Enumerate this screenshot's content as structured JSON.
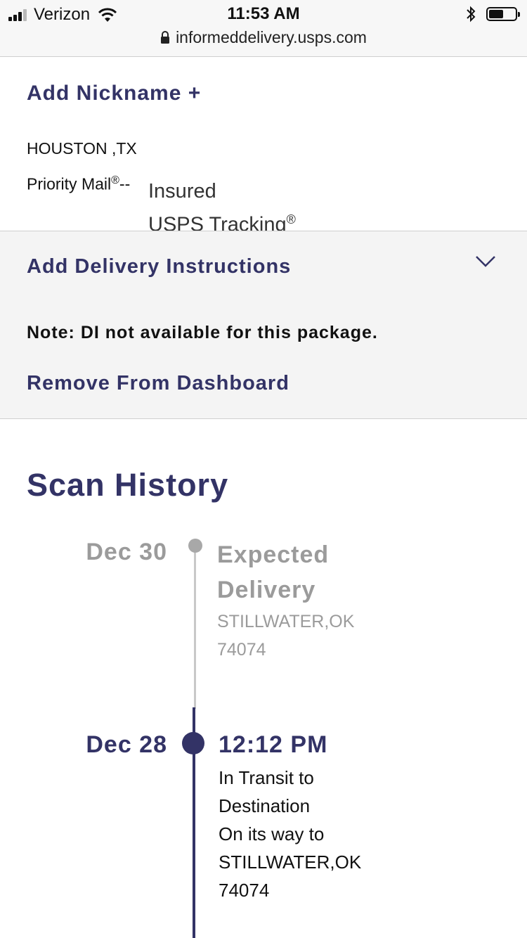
{
  "status_bar": {
    "carrier": "Verizon",
    "time": "11:53 AM",
    "url": "informeddelivery.usps.com",
    "signal_bars_filled": 3,
    "signal_bars_total": 4,
    "battery_level": 0.55
  },
  "package": {
    "nickname_link": "Add Nickname +",
    "origin": "HOUSTON ,TX",
    "service_name": "Priority Mail",
    "service_reg": "®",
    "service_sep": "--",
    "service_extra_line1": "Insured",
    "service_extra_line2": "USPS Tracking",
    "service_extra_reg": "®"
  },
  "delivery_instructions": {
    "title": "Add Delivery Instructions",
    "note": "Note: DI not available for this package."
  },
  "remove": {
    "label": "Remove From Dashboard"
  },
  "scan_history": {
    "title": "Scan History",
    "events": [
      {
        "date": "Dec 30",
        "title_line1": "Expected",
        "title_line2": "Delivery",
        "location_line1": "STILLWATER,OK",
        "location_line2": "74074"
      },
      {
        "date": "Dec 28",
        "time": "12:12 PM",
        "desc_line1": "In Transit to",
        "desc_line2": "Destination",
        "desc_line3": "On its way to",
        "desc_line4": "STILLWATER,OK",
        "desc_line5": "74074"
      }
    ]
  },
  "colors": {
    "brand_purple": "#333366",
    "muted_gray": "#9b9b9b",
    "section_bg": "#f4f4f4"
  }
}
